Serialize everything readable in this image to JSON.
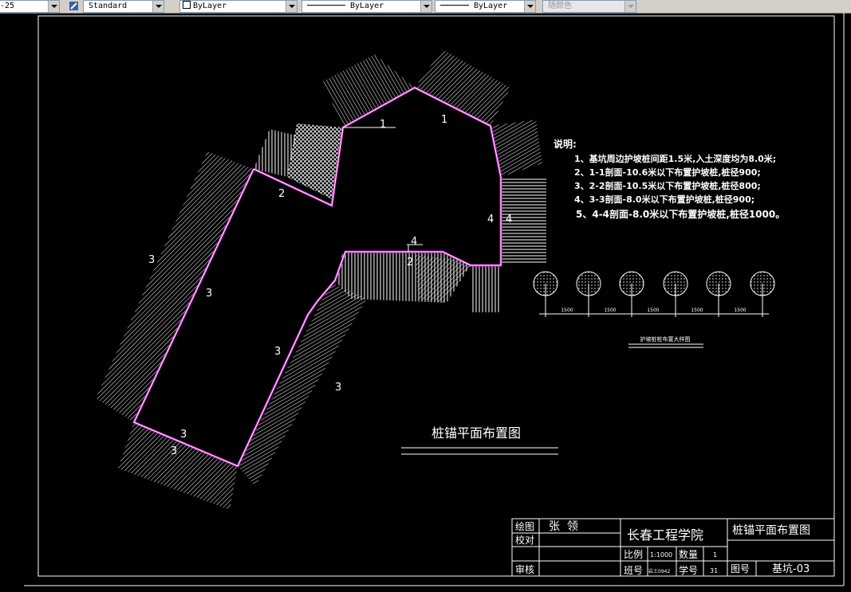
{
  "toolbar": {
    "dimstyle": "-25",
    "textstyle": "Standard",
    "layer": "ByLayer",
    "linetype": "ByLayer",
    "lineweight": "ByLayer",
    "color": "随颜色"
  },
  "drawing": {
    "notes": {
      "heading": "说明:",
      "lines": [
        "1、基坑周边护坡桩间距1.5米,入土深度均为8.0米;",
        "2、1-1剖面-10.6米以下布置护坡桩,桩径900;",
        "3、2-2剖面-10.5米以下布置护坡桩,桩径800;",
        "4、3-3剖面-8.0米以下布置护坡桩,桩径900;",
        "5、4-4剖面-8.0米以下布置护坡桩,桩径1000。"
      ]
    },
    "pile_detail": {
      "spacings": [
        "1500",
        "1500",
        "1500",
        "1500",
        "1500"
      ],
      "caption": "护坡桩桩布置大样图"
    },
    "section_labels": [
      "1",
      "1",
      "2",
      "3",
      "3",
      "3",
      "3",
      "3",
      "3",
      "4",
      "4",
      "4",
      "2"
    ],
    "main_title": "桩锚平面布置图",
    "title_block": {
      "draw_label": "绘图",
      "draw_value": "张  领",
      "check_label": "校对",
      "review_label": "审核",
      "school": "长春工程学院",
      "drawing_name": "桩锚平面布置图",
      "scale_label": "比例",
      "scale_value": "1:1000",
      "qty_label": "数量",
      "qty_value": "1",
      "class_label": "班号",
      "class_value": "岩土0942",
      "sid_label": "学号",
      "sid_value": "31",
      "dwgno_label": "图号",
      "dwgno_value": "基坑-03"
    }
  },
  "colors": {
    "background": "#000000",
    "linework": "#ffffff",
    "pit_outline": "#c020c0",
    "toolbar_bg": "#d4d0c8"
  }
}
